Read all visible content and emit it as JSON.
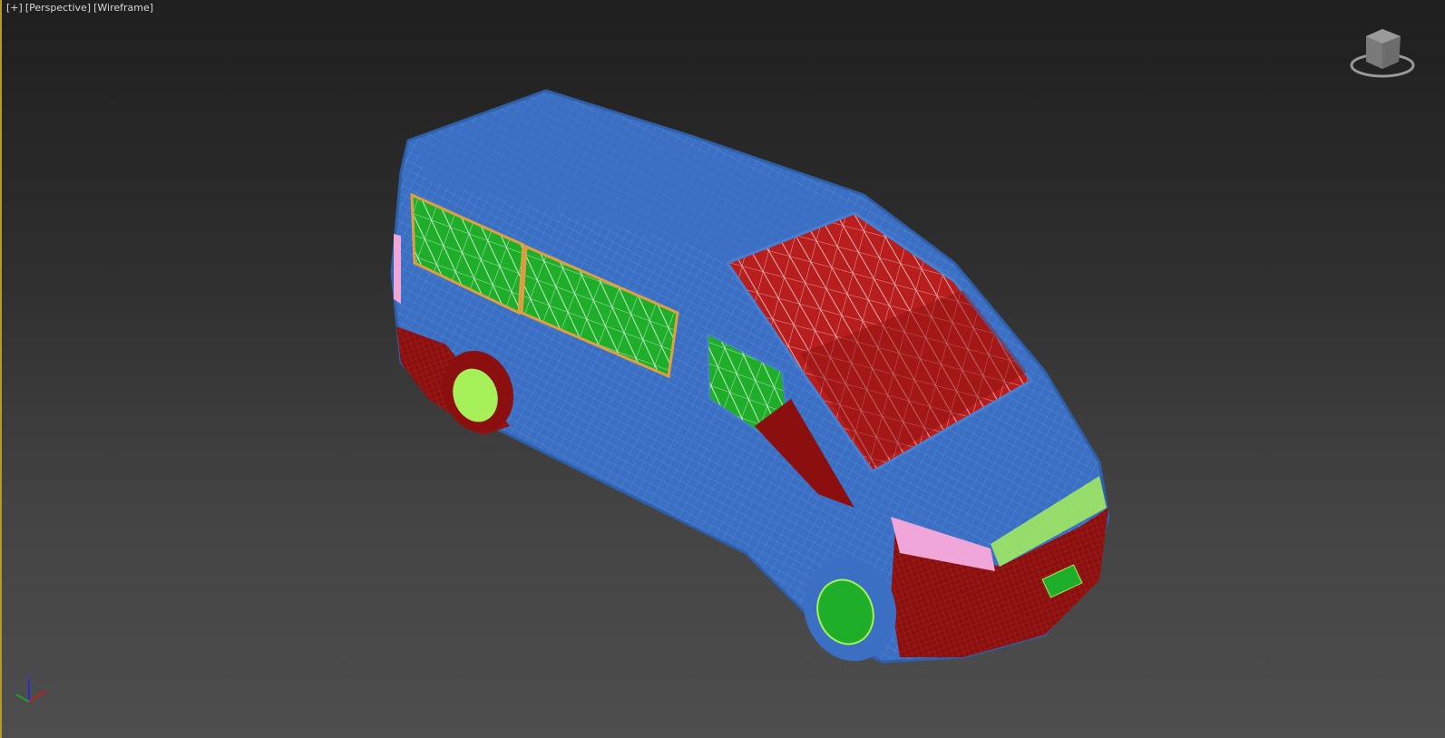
{
  "viewport": {
    "labels": {
      "menu": "[+]",
      "view": "[Perspective]",
      "shading": "[Wireframe]"
    },
    "axis_tripod": {
      "z_label": "z"
    },
    "colors": {
      "body": "#3a6fc4",
      "glass": "#1fae2a",
      "lower_body": "#8c0f0f",
      "accent": "#a6f05a",
      "interior": "#e86a6a",
      "trim": "#f0a6d8",
      "frame_border": "#b59a2a"
    }
  }
}
